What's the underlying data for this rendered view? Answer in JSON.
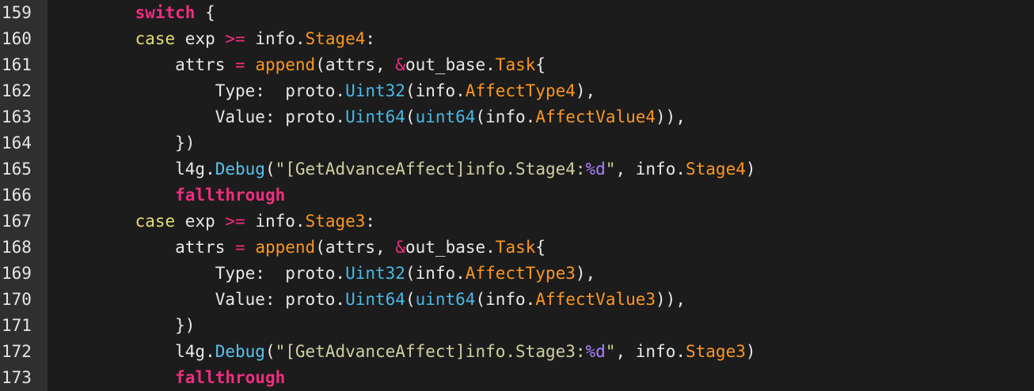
{
  "colors": {
    "background": "#1c1c1c",
    "gutter": "#2f2f2f",
    "keyword": "#ef2d80",
    "case": "#e6db74",
    "field": "#fd9720",
    "type": "#48b9e6",
    "string": "#cfcfa0",
    "format": "#ae81ff",
    "plain": "#e8e8e8"
  },
  "line_numbers": [
    "159",
    "160",
    "161",
    "162",
    "163",
    "164",
    "165",
    "166",
    "167",
    "168",
    "169",
    "170",
    "171",
    "172",
    "173"
  ],
  "lines": [
    [
      {
        "c": "tok-plain",
        "t": "    "
      },
      {
        "c": "tok-kw",
        "t": "switch"
      },
      {
        "c": "tok-plain",
        "t": " {"
      }
    ],
    [
      {
        "c": "tok-plain",
        "t": "    "
      },
      {
        "c": "tok-case",
        "t": "case"
      },
      {
        "c": "tok-plain",
        "t": " exp "
      },
      {
        "c": "tok-op",
        "t": ">="
      },
      {
        "c": "tok-plain",
        "t": " info."
      },
      {
        "c": "tok-field",
        "t": "Stage4"
      },
      {
        "c": "tok-plain",
        "t": ":"
      }
    ],
    [
      {
        "c": "tok-plain",
        "t": "        attrs "
      },
      {
        "c": "tok-op",
        "t": "="
      },
      {
        "c": "tok-plain",
        "t": " "
      },
      {
        "c": "tok-call",
        "t": "append"
      },
      {
        "c": "tok-plain",
        "t": "(attrs, "
      },
      {
        "c": "tok-op",
        "t": "&"
      },
      {
        "c": "tok-plain",
        "t": "out_base."
      },
      {
        "c": "tok-field",
        "t": "Task"
      },
      {
        "c": "tok-plain",
        "t": "{"
      }
    ],
    [
      {
        "c": "tok-plain",
        "t": "            Type:  proto."
      },
      {
        "c": "tok-type",
        "t": "Uint32"
      },
      {
        "c": "tok-plain",
        "t": "(info."
      },
      {
        "c": "tok-field",
        "t": "AffectType4"
      },
      {
        "c": "tok-plain",
        "t": "),"
      }
    ],
    [
      {
        "c": "tok-plain",
        "t": "            Value: proto."
      },
      {
        "c": "tok-type",
        "t": "Uint64"
      },
      {
        "c": "tok-plain",
        "t": "("
      },
      {
        "c": "tok-type",
        "t": "uint64"
      },
      {
        "c": "tok-plain",
        "t": "(info."
      },
      {
        "c": "tok-field",
        "t": "AffectValue4"
      },
      {
        "c": "tok-plain",
        "t": ")),"
      }
    ],
    [
      {
        "c": "tok-plain",
        "t": "        })"
      }
    ],
    [
      {
        "c": "tok-plain",
        "t": "        l4g."
      },
      {
        "c": "tok-func",
        "t": "Debug"
      },
      {
        "c": "tok-plain",
        "t": "("
      },
      {
        "c": "tok-str",
        "t": "\"[GetAdvanceAffect]info.Stage4:"
      },
      {
        "c": "tok-fmt",
        "t": "%d"
      },
      {
        "c": "tok-str",
        "t": "\""
      },
      {
        "c": "tok-plain",
        "t": ", info."
      },
      {
        "c": "tok-field",
        "t": "Stage4"
      },
      {
        "c": "tok-plain",
        "t": ")"
      }
    ],
    [
      {
        "c": "tok-plain",
        "t": "        "
      },
      {
        "c": "tok-kw",
        "t": "fallthrough"
      }
    ],
    [
      {
        "c": "tok-plain",
        "t": "    "
      },
      {
        "c": "tok-case",
        "t": "case"
      },
      {
        "c": "tok-plain",
        "t": " exp "
      },
      {
        "c": "tok-op",
        "t": ">="
      },
      {
        "c": "tok-plain",
        "t": " info."
      },
      {
        "c": "tok-field",
        "t": "Stage3"
      },
      {
        "c": "tok-plain",
        "t": ":"
      }
    ],
    [
      {
        "c": "tok-plain",
        "t": "        attrs "
      },
      {
        "c": "tok-op",
        "t": "="
      },
      {
        "c": "tok-plain",
        "t": " "
      },
      {
        "c": "tok-call",
        "t": "append"
      },
      {
        "c": "tok-plain",
        "t": "(attrs, "
      },
      {
        "c": "tok-op",
        "t": "&"
      },
      {
        "c": "tok-plain",
        "t": "out_base."
      },
      {
        "c": "tok-field",
        "t": "Task"
      },
      {
        "c": "tok-plain",
        "t": "{"
      }
    ],
    [
      {
        "c": "tok-plain",
        "t": "            Type:  proto."
      },
      {
        "c": "tok-type",
        "t": "Uint32"
      },
      {
        "c": "tok-plain",
        "t": "(info."
      },
      {
        "c": "tok-field",
        "t": "AffectType3"
      },
      {
        "c": "tok-plain",
        "t": "),"
      }
    ],
    [
      {
        "c": "tok-plain",
        "t": "            Value: proto."
      },
      {
        "c": "tok-type",
        "t": "Uint64"
      },
      {
        "c": "tok-plain",
        "t": "("
      },
      {
        "c": "tok-type",
        "t": "uint64"
      },
      {
        "c": "tok-plain",
        "t": "(info."
      },
      {
        "c": "tok-field",
        "t": "AffectValue3"
      },
      {
        "c": "tok-plain",
        "t": ")),"
      }
    ],
    [
      {
        "c": "tok-plain",
        "t": "        })"
      }
    ],
    [
      {
        "c": "tok-plain",
        "t": "        l4g."
      },
      {
        "c": "tok-func",
        "t": "Debug"
      },
      {
        "c": "tok-plain",
        "t": "("
      },
      {
        "c": "tok-str",
        "t": "\"[GetAdvanceAffect]info.Stage3:"
      },
      {
        "c": "tok-fmt",
        "t": "%d"
      },
      {
        "c": "tok-str",
        "t": "\""
      },
      {
        "c": "tok-plain",
        "t": ", info."
      },
      {
        "c": "tok-field",
        "t": "Stage3"
      },
      {
        "c": "tok-plain",
        "t": ")"
      }
    ],
    [
      {
        "c": "tok-plain",
        "t": "        "
      },
      {
        "c": "tok-kw",
        "t": "fallthrough"
      }
    ]
  ]
}
